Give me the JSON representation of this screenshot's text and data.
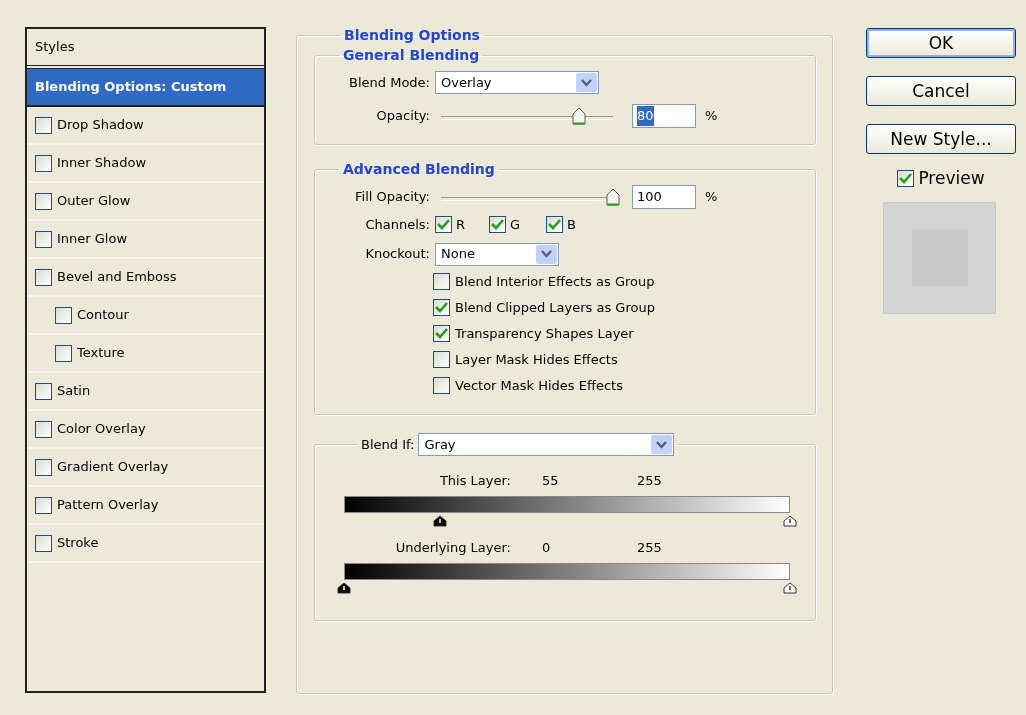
{
  "styles_panel": {
    "header": "Styles",
    "items": [
      {
        "label": "Blending Options: Custom",
        "kind": "option",
        "selected": true
      },
      {
        "label": "Drop Shadow",
        "kind": "effect",
        "checked": false,
        "selected": false
      },
      {
        "label": "Inner Shadow",
        "kind": "effect",
        "checked": false,
        "selected": false
      },
      {
        "label": "Outer Glow",
        "kind": "effect",
        "checked": false,
        "selected": false
      },
      {
        "label": "Inner Glow",
        "kind": "effect",
        "checked": false,
        "selected": false
      },
      {
        "label": "Bevel and Emboss",
        "kind": "effect",
        "checked": false,
        "selected": false,
        "children": [
          {
            "label": "Contour",
            "kind": "effect",
            "checked": false,
            "selected": false
          },
          {
            "label": "Texture",
            "kind": "effect",
            "checked": false,
            "selected": false
          }
        ]
      },
      {
        "label": "Satin",
        "kind": "effect",
        "checked": false,
        "selected": false
      },
      {
        "label": "Color Overlay",
        "kind": "effect",
        "checked": false,
        "selected": false
      },
      {
        "label": "Gradient Overlay",
        "kind": "effect",
        "checked": false,
        "selected": false
      },
      {
        "label": "Pattern Overlay",
        "kind": "effect",
        "checked": false,
        "selected": false
      },
      {
        "label": "Stroke",
        "kind": "effect",
        "checked": false,
        "selected": false
      }
    ]
  },
  "blending_options": {
    "title": "Blending Options",
    "general_blending": {
      "title": "General Blending",
      "blend_mode": {
        "label": "Blend Mode:",
        "value": "Overlay"
      },
      "opacity": {
        "label": "Opacity:",
        "level": 0.8,
        "value": "80",
        "text_selected": true,
        "unit": "%"
      }
    },
    "advanced_blending": {
      "title": "Advanced Blending",
      "fill_opacity": {
        "label": "Fill Opacity:",
        "level": 1,
        "value": "100",
        "text_selected": false,
        "unit": "%"
      },
      "channels": {
        "label": "Channels:",
        "items": [
          {
            "label": "R",
            "checked": true
          },
          {
            "label": "G",
            "checked": true
          },
          {
            "label": "B",
            "checked": true
          }
        ]
      },
      "knockout": {
        "label": "Knockout:",
        "value": "None"
      },
      "options": [
        {
          "label": "Blend Interior Effects as Group",
          "checked": false
        },
        {
          "label": "Blend Clipped Layers as Group",
          "checked": true
        },
        {
          "label": "Transparency Shapes Layer",
          "checked": true
        },
        {
          "label": "Layer Mask Hides Effects",
          "checked": false
        },
        {
          "label": "Vector Mask Hides Effects",
          "checked": false
        }
      ]
    },
    "blend_if": {
      "label": "Blend If:",
      "value": "Gray",
      "ramps": [
        {
          "label": "This Layer:",
          "low": "55",
          "high": "255",
          "thumbs": [
            {
              "level": 0.216
            },
            {
              "level": 1
            }
          ]
        },
        {
          "label": "Underlying Layer:",
          "low": "0",
          "high": "255",
          "thumbs": [
            {
              "level": 0
            },
            {
              "level": 1
            }
          ]
        }
      ]
    }
  },
  "buttons": [
    {
      "label": "OK",
      "default": true
    },
    {
      "label": "Cancel",
      "default": false
    },
    {
      "label": "New Style...",
      "default": false
    }
  ],
  "preview": {
    "label": "Preview",
    "checked": true
  }
}
